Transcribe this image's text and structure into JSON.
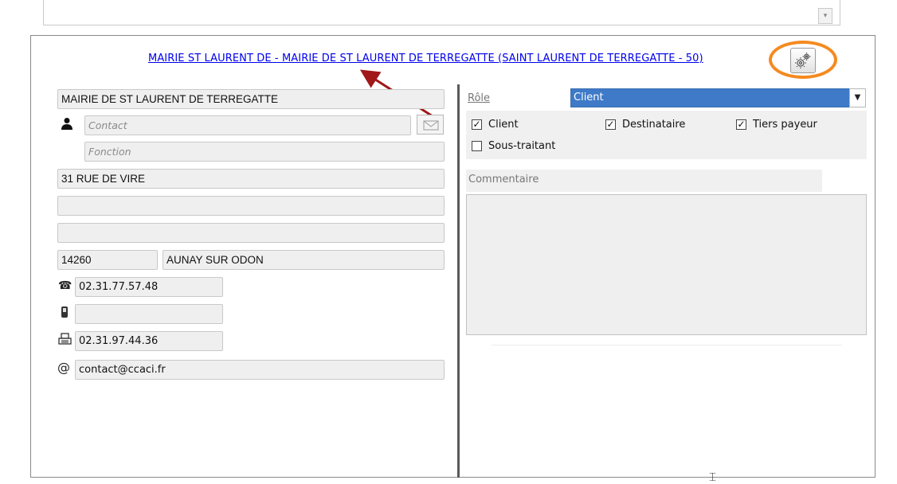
{
  "header": {
    "link_text": "MAIRIE ST LAURENT DE - MAIRIE DE ST LAURENT DE TERREGATTE (SAINT LAURENT DE TERREGATTE - 50)",
    "settings_icon": "gear-icon"
  },
  "left": {
    "name": "MAIRIE DE ST LAURENT DE TERREGATTE",
    "contact_placeholder": "Contact",
    "fonction_placeholder": "Fonction",
    "address1": "31 RUE DE VIRE",
    "address2": "",
    "address3": "",
    "postal_code": "14260",
    "city": "AUNAY SUR ODON",
    "phone": "02.31.77.57.48",
    "mobile": "",
    "fax": "02.31.97.44.36",
    "email": "contact@ccaci.fr",
    "icons": {
      "contact": "person-icon",
      "mail": "envelope-icon",
      "phone": "telephone-icon",
      "mobile": "mobile-phone-icon",
      "fax": "fax-icon",
      "email": "at-sign-icon"
    }
  },
  "right": {
    "role_label": "Rôle",
    "role_value": "Client",
    "checkboxes": [
      {
        "label": "Client",
        "checked": true
      },
      {
        "label": "Destinataire",
        "checked": true
      },
      {
        "label": "Tiers payeur",
        "checked": true
      },
      {
        "label": "Sous-traitant",
        "checked": false
      }
    ],
    "comment_label": "Commentaire",
    "comment_value": ""
  },
  "colors": {
    "link": "#0000ee",
    "selection": "#3e7ac7",
    "highlight_ring": "#f58a1f",
    "arrow": "#a01818"
  }
}
